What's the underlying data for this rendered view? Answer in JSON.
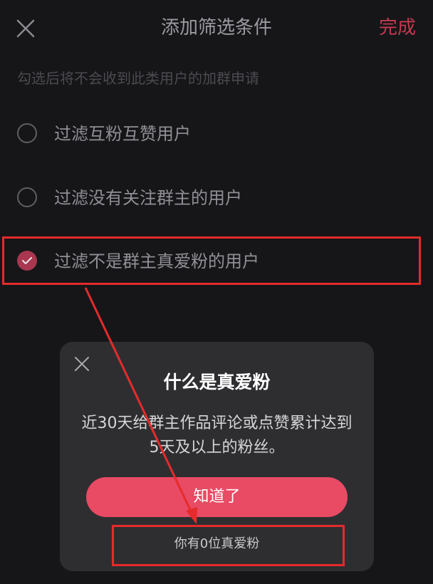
{
  "header": {
    "title": "添加筛选条件",
    "done_label": "完成"
  },
  "hint": "勾选后将不会收到此类用户的加群申请",
  "options": [
    {
      "label": "过滤互粉互赞用户",
      "checked": false
    },
    {
      "label": "过滤没有关注群主的用户",
      "checked": false
    },
    {
      "label": "过滤不是群主真爱粉的用户",
      "checked": true
    }
  ],
  "modal": {
    "title": "什么是真爱粉",
    "description": "近30天给群主作品评论或点赞累计达到5天及以上的粉丝。",
    "confirm_label": "知道了",
    "fans_count_link": "你有0位真爱粉"
  },
  "colors": {
    "background": "#161619",
    "accent": "#e94a64",
    "done": "#c23a4e",
    "annotation": "#e52b2b"
  }
}
